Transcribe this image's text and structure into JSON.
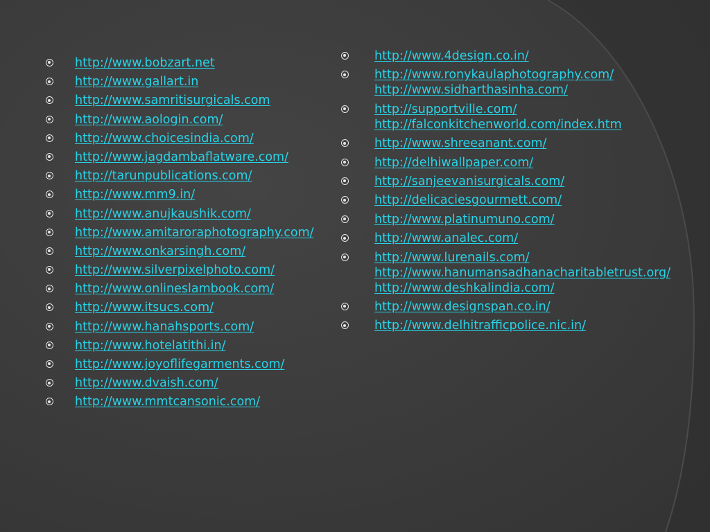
{
  "colors": {
    "background": "#3a3a3a",
    "link": "#27d3e8",
    "bullet": "#e6e6e6"
  },
  "left_column": [
    {
      "links": [
        "http://www.bobzart.net"
      ]
    },
    {
      "links": [
        "http://www.gallart.in"
      ]
    },
    {
      "links": [
        "http://www.samritisurgicals.com"
      ]
    },
    {
      "links": [
        "http://www.aologin.com/"
      ]
    },
    {
      "links": [
        "http://www.choicesindia.com/"
      ]
    },
    {
      "links": [
        "http://www.jagdambaflatware.com/"
      ]
    },
    {
      "links": [
        "http://tarunpublications.com/"
      ]
    },
    {
      "links": [
        "http://www.mm9.in/"
      ]
    },
    {
      "links": [
        "http://www.anujkaushik.com/"
      ]
    },
    {
      "links": [
        "http://www.amitaroraphotography.com/"
      ]
    },
    {
      "links": [
        "http://www.onkarsingh.com/"
      ]
    },
    {
      "links": [
        "http://www.silverpixelphoto.com/"
      ]
    },
    {
      "links": [
        "http://www.onlineslambook.com/"
      ]
    },
    {
      "links": [
        "http://www.itsucs.com/"
      ]
    },
    {
      "links": [
        "http://www.hanahsports.com/"
      ]
    },
    {
      "links": [
        "http://www.hotelatithi.in/"
      ]
    },
    {
      "links": [
        "http://www.joyoflifegarments.com/"
      ]
    },
    {
      "links": [
        "http://www.dvaish.com/"
      ]
    },
    {
      "links": [
        "http://www.mmtcansonic.com/"
      ]
    }
  ],
  "right_column": [
    {
      "links": [
        "http://www.4design.co.in/"
      ]
    },
    {
      "links": [
        "http://www.ronykaulaphotography.com/",
        "http://www.sidharthasinha.com/"
      ]
    },
    {
      "links": [
        "http://supportville.com/",
        "http://falconkitchenworld.com/index.htm"
      ]
    },
    {
      "links": [
        "http://www.shreeanant.com/"
      ]
    },
    {
      "links": [
        "http://delhiwallpaper.com/"
      ]
    },
    {
      "links": [
        "http://sanjeevanisurgicals.com/"
      ]
    },
    {
      "links": [
        "http://delicaciesgourmett.com/"
      ]
    },
    {
      "links": [
        "http://www.platinumuno.com/"
      ]
    },
    {
      "links": [
        "http://www.analec.com/"
      ]
    },
    {
      "links": [
        "http://www.lurenails.com/",
        "http://www.hanumansadhanacharitabletrust.org/",
        "http://www.deshkalindia.com/"
      ]
    },
    {
      "links": [
        "http://www.designspan.co.in/"
      ]
    },
    {
      "links": [
        "http://www.delhitrafficpolice.nic.in/"
      ]
    }
  ]
}
